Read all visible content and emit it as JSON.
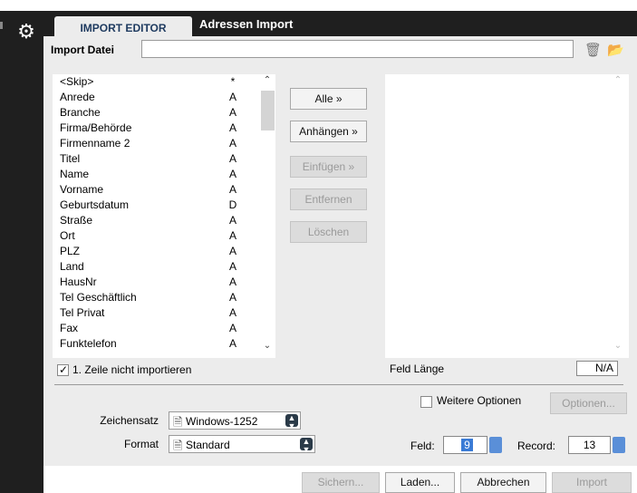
{
  "tabs": {
    "active": "IMPORT EDITOR",
    "other": "Adressen Import"
  },
  "import_file": {
    "label": "Import Datei",
    "value": ""
  },
  "fields": [
    {
      "name": "<Skip>",
      "type": "*"
    },
    {
      "name": "Anrede",
      "type": "A"
    },
    {
      "name": "Branche",
      "type": "A"
    },
    {
      "name": "Firma/Behörde",
      "type": "A"
    },
    {
      "name": "Firmenname 2",
      "type": "A"
    },
    {
      "name": "Titel",
      "type": "A"
    },
    {
      "name": "Name",
      "type": "A"
    },
    {
      "name": "Vorname",
      "type": "A"
    },
    {
      "name": "Geburtsdatum",
      "type": "D"
    },
    {
      "name": "Straße",
      "type": "A"
    },
    {
      "name": "Ort",
      "type": "A"
    },
    {
      "name": "PLZ",
      "type": "A"
    },
    {
      "name": "Land",
      "type": "A"
    },
    {
      "name": "HausNr",
      "type": "A"
    },
    {
      "name": "Tel Geschäftlich",
      "type": "A"
    },
    {
      "name": "Tel Privat",
      "type": "A"
    },
    {
      "name": "Fax",
      "type": "A"
    },
    {
      "name": "Funktelefon",
      "type": "A"
    }
  ],
  "actions": {
    "alle": "Alle »",
    "anhaengen": "Anhängen »",
    "einfuegen": "Einfügen »",
    "entfernen": "Entfernen",
    "loeschen": "Löschen"
  },
  "skip_first_row": {
    "label": "1. Zeile nicht importieren",
    "checked": true
  },
  "feld_laenge": {
    "label": "Feld Länge",
    "value": "N/A"
  },
  "weitere_optionen": {
    "label": "Weitere Optionen",
    "checked": false
  },
  "optionen_button": "Optionen...",
  "zeichensatz": {
    "label": "Zeichensatz",
    "value": "Windows-1252"
  },
  "format": {
    "label": "Format",
    "value": "Standard"
  },
  "feld": {
    "label": "Feld:",
    "value": "9"
  },
  "record": {
    "label": "Record:",
    "value": "13"
  },
  "bottom_buttons": {
    "sichern": "Sichern...",
    "laden": "Laden...",
    "abbrechen": "Abbrechen",
    "import": "Import"
  },
  "colors": {
    "dark": "#1f1f1f",
    "panel": "#ececec",
    "accent": "#3a7bd5"
  }
}
